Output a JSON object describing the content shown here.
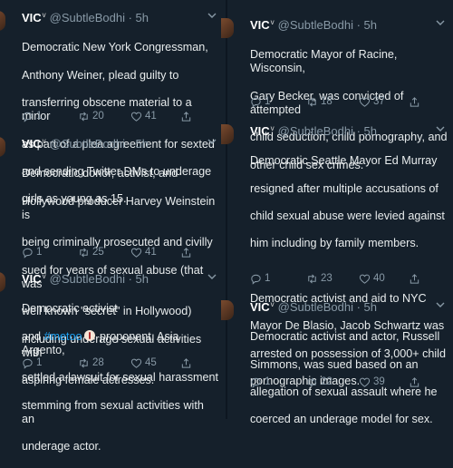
{
  "left": [
    {
      "name": "VIC",
      "verified": "v",
      "handle": "@SubtleBodhi · 5h",
      "lines": [
        "Democratic New York Congressman,",
        "Anthony Weiner, plead guilty to",
        "transferring obscene material to a minor",
        "as part of a plea agreement for sexted",
        "and sending Twitter DMs to underage",
        "girls as young as 15."
      ],
      "replies": "1",
      "retweets": "20",
      "likes": "41"
    },
    {
      "name": "VIC",
      "verified": "v",
      "handle": "@SubtleBodhi · 5h",
      "lines": [
        "Democratic donor, activist, and",
        "Hollywood producer Harvey Weinstein is",
        "being criminally prosecuted and civilly",
        "sued for years of sexual abuse (that was",
        "well known \"secret\" in Hollywood)",
        "including underage sexual activities with",
        "aspiring female actresses."
      ],
      "replies": "1",
      "retweets": "25",
      "likes": "41"
    },
    {
      "name": "VIC",
      "verified": "v",
      "handle": "@SubtleBodhi · 5h",
      "line1": "Democratic activist",
      "line2_pre": "and ",
      "hashtag": "#metoo",
      "line2_post": " proponent, Asia Argento,",
      "lines_rest": [
        "settled a lawsuit for sexual harassment",
        "stemming from sexual activities with an",
        "underage actor."
      ],
      "replies": "1",
      "retweets": "28",
      "likes": "45"
    }
  ],
  "right": [
    {
      "name": "VIC",
      "verified": "v",
      "handle": "@SubtleBodhi · 5h",
      "lines": [
        "Democratic Mayor of Racine, Wisconsin,",
        "Gary Becker, was convicted of attempted",
        "child seduction, child pornography, and",
        "other child sex crimes."
      ],
      "replies": "1",
      "retweets": "18",
      "likes": "37"
    },
    {
      "name": "VIC",
      "verified": "v",
      "handle": "@SubtleBodhi · 5h",
      "lines": [
        "Democratic Seattle Mayor Ed Murray",
        "resigned after multiple accusations of",
        "child sexual abuse were levied against",
        "him including by family members.",
        "",
        "Democratic activist and aid to NYC",
        "Mayor De Blasio, Jacob Schwartz was",
        "arrested on possession of 3,000+ child",
        "pornographic images."
      ],
      "replies": "1",
      "retweets": "23",
      "likes": "40"
    },
    {
      "name": "VIC",
      "verified": "v",
      "handle": "@SubtleBodhi · 5h",
      "lines": [
        "Democratic activist and actor, Russell",
        "Simmons, was sued based on an",
        "allegation of sexual assault where he",
        "coerced an underage model for sex."
      ],
      "replies": "1",
      "retweets": "22",
      "likes": "39"
    }
  ]
}
